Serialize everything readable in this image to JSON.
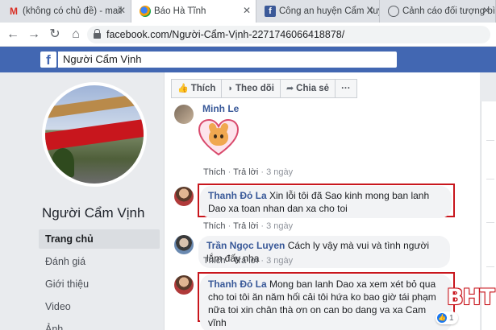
{
  "browser": {
    "tabs": [
      {
        "title": "(không có chủ đề) - mail",
        "icon": "gmail-icon"
      },
      {
        "title": "Báo Hà Tĩnh",
        "icon": "baohatinh-icon"
      },
      {
        "title": "Công an huyện Cẩm Xuy",
        "icon": "facebook-icon"
      },
      {
        "title": "Cảnh cáo đối tượng bình",
        "icon": "globe-icon"
      }
    ],
    "url": "facebook.com/Người-Cẩm-Vịnh-2271746066418878/"
  },
  "facebook": {
    "search_value": "Người Cẩm Vịnh",
    "logo": "f",
    "brand_color": "#4267b2"
  },
  "page": {
    "name": "Người Cẩm Vịnh",
    "nav": [
      "Trang chủ",
      "Đánh giá",
      "Giới thiệu",
      "Video",
      "Ảnh"
    ],
    "active_nav": "Trang chủ"
  },
  "actions": {
    "like": "Thích",
    "follow": "Theo dõi",
    "share": "Chia sẻ",
    "more": "···"
  },
  "comments": [
    {
      "name": "Minh Le",
      "text": "",
      "sticker": "heart-fox-sticker",
      "like": "Thích",
      "reply": "Trả lời",
      "time": "3 ngày"
    },
    {
      "name": "Thanh Đỏ La",
      "text": "Xin lỗi tôi đã Sao kinh mong ban lanh Dao xa toan nhan dan xa cho toi",
      "like": "Thích",
      "reply": "Trả lời",
      "time": "3 ngày",
      "highlighted": true
    },
    {
      "name": "Trần Ngọc Luyen",
      "text": "Cách ly vậy mà vui và tình người lắm đấy nha",
      "like": "Thích",
      "reply": "Trả lời",
      "time": "3 ngày"
    },
    {
      "name": "Thanh Đỏ La",
      "text": "Mong ban lanh Dao xa xem xét bỏ qua cho toi tôi ăn năm hối cải tôi hứa ko bao giờ tái phạm nữa toi xin chân thà ơn on can bo dang va xa Cam vĩnh",
      "highlighted": true,
      "reaction_count": "1"
    }
  ],
  "watermark": "BHT",
  "colors": {
    "highlight": "#c8161d",
    "link": "#385898"
  }
}
